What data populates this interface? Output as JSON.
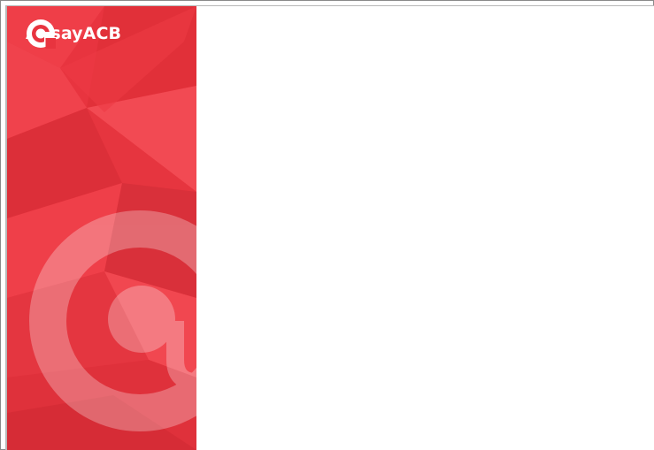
{
  "brand": {
    "name": "AhsayACB",
    "logo_icon": "ahsay-at-logo-icon"
  },
  "colors": {
    "brand_red": "#e8343f",
    "brand_red_light": "#f24a53",
    "brand_red_dark": "#d42a34",
    "content_background": "#ffffff"
  },
  "content": {}
}
